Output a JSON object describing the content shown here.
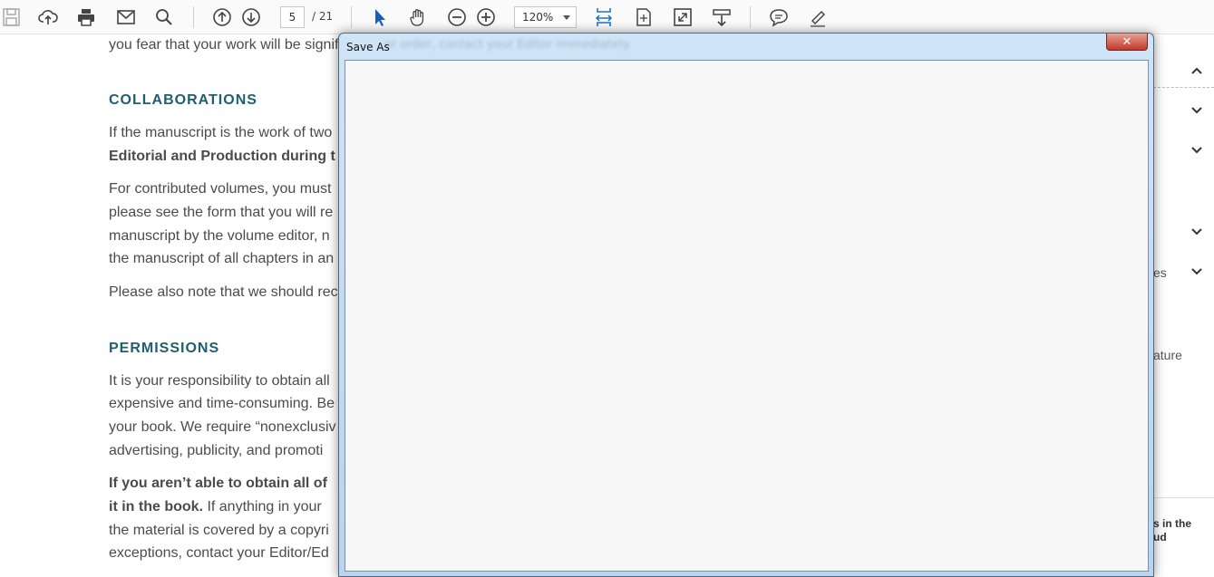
{
  "toolbar": {
    "page_current": "5",
    "page_total": "/ 21",
    "zoom": "120%"
  },
  "document": {
    "lines": [
      {
        "text": "you fear that your work will be signific",
        "style": "normal"
      },
      {
        "text": "COLLABORATIONS",
        "style": "heading"
      },
      {
        "text": "If the manuscript is the work of two",
        "style": "normal"
      },
      {
        "text": "Editorial and Production during t",
        "style": "bold"
      },
      {
        "text": "For contributed volumes, you must",
        "style": "normal"
      },
      {
        "text": "please see the form that you will re",
        "style": "normal"
      },
      {
        "text": "manuscript by the volume editor, n",
        "style": "normal"
      },
      {
        "text": "the manuscript of all chapters in an",
        "style": "normal"
      },
      {
        "text": "Please also note that we should rec",
        "style": "normal"
      },
      {
        "text": "PERMISSIONS",
        "style": "heading"
      },
      {
        "text": "It is your responsibility to obtain all",
        "style": "normal"
      },
      {
        "text": "expensive and time-consuming.  Be",
        "style": "normal"
      },
      {
        "text": "your book. We require “nonexclusiv",
        "style": "normal"
      },
      {
        "text": "advertising, publicity, and promoti",
        "style": "normal"
      },
      {
        "text": "If you aren’t able to obtain all of",
        "style": "bold"
      },
      {
        "text": "it in the book.",
        "style": "mixed",
        "rest": " If anything in your"
      },
      {
        "text": "the material is covered by a copyri",
        "style": "normal"
      },
      {
        "text": "exceptions, contact your Editor/Ed",
        "style": "normal"
      }
    ]
  },
  "right_pane": {
    "text_es": "es",
    "text_ature": "ature",
    "bold_line1": "s in the",
    "bold_line2": "ud"
  },
  "dialog": {
    "title": "Save As",
    "background_text": "or order, contact your Editor immediately.",
    "close_symbol": "✕"
  },
  "colors": {
    "heading": "#1f5f6f",
    "toolbar_blue": "#1a73c8",
    "dialog_frame": "#b9d4ef"
  }
}
